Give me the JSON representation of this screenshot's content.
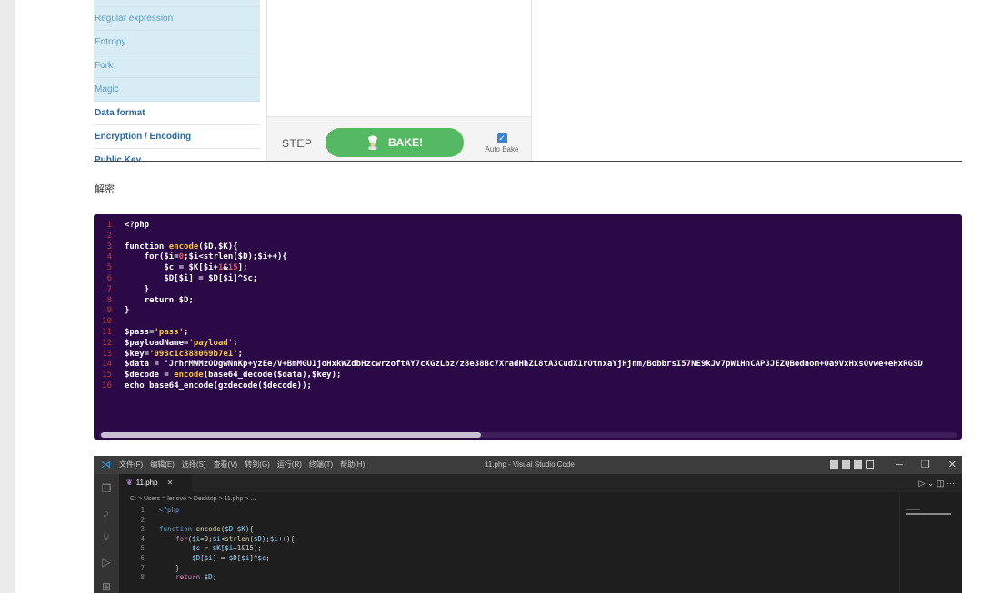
{
  "cyberchef": {
    "categories": [
      {
        "label": "Regular expression",
        "style": "light"
      },
      {
        "label": "Entropy",
        "style": "light"
      },
      {
        "label": "Fork",
        "style": "light"
      },
      {
        "label": "Magic",
        "style": "light"
      },
      {
        "label": "Data format",
        "style": "bold"
      },
      {
        "label": "Encryption / Encoding",
        "style": "bold"
      },
      {
        "label": "Public Key",
        "style": "bold"
      }
    ],
    "step_label": "STEP",
    "bake_label": "BAKE!",
    "auto_bake_label": "Auto Bake",
    "auto_bake_checked": true
  },
  "caption": "解密",
  "code_block": {
    "lines": [
      "<?php",
      "",
      "function encode($D,$K){",
      "    for($i=0;$i<strlen($D);$i++){",
      "        $c = $K[$i+1&15];",
      "        $D[$i] = $D[$i]^$c;",
      "    }",
      "    return $D;",
      "}",
      "",
      "$pass='pass';",
      "$payloadName='payload';",
      "$key='093c1c388069b7e1';",
      "$data = 'JrhrMWMzODgwNnKp+yzEe/V+BmMGU1joHxkWZdbHzcwrzoftAY7cXGzLbz/z8e38Bc7XradHhZL8tA3CudX1rOtnxaYjHjnm/BobbrsI57NE9kJv7pW1HnCAP3JEZQBodnom+Oa9VxHxsQvwe+eHxRGSD",
      "$decode = encode(base64_decode($data),$key);",
      "echo base64_encode(gzdecode($decode));"
    ]
  },
  "vscode": {
    "menu": [
      "文件(F)",
      "编辑(E)",
      "选择(S)",
      "查看(V)",
      "转到(G)",
      "运行(R)",
      "终端(T)",
      "帮助(H)"
    ],
    "window_title": "11.php - Visual Studio Code",
    "tab_label": "11.php",
    "breadcrumb": "C: > Users > lenovo > Desktop > 11.php > ...",
    "code_lines": [
      "<?php",
      "",
      "function encode($D,$K){",
      "    for($i=0;$i<strlen($D);$i++){",
      "        $c = $K[$i+1&15];",
      "        $D[$i] = $D[$i]^$c;",
      "    }",
      "    return $D;"
    ]
  }
}
